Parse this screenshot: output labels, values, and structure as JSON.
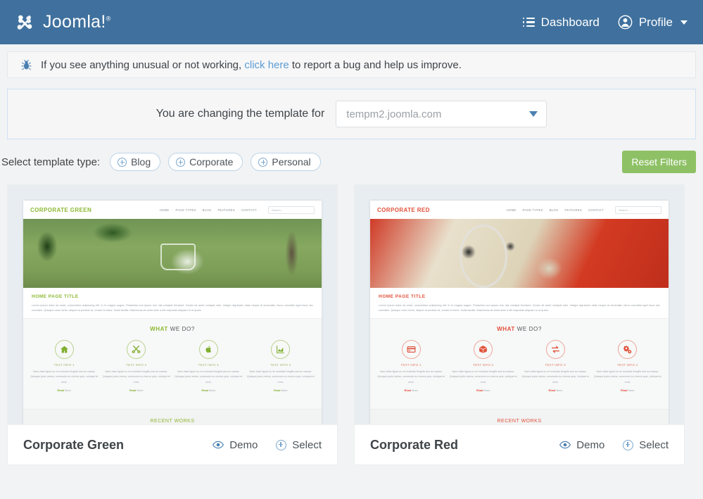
{
  "header": {
    "brand_name": "Joomla!",
    "brand_tm": "®",
    "dashboard_label": "Dashboard",
    "profile_label": "Profile",
    "bg_color": "#40719e"
  },
  "notice": {
    "icon": "bug-icon",
    "text_before": "If you see anything unusual or not working,",
    "link_text": "click here",
    "text_after": "to report a bug and help us improve."
  },
  "template_panel": {
    "label": "You are changing the template for",
    "selected_site": "tempm2.joomla.com"
  },
  "filters": {
    "label": "Select template type:",
    "options": [
      {
        "label": "Blog"
      },
      {
        "label": "Corporate"
      },
      {
        "label": "Personal"
      }
    ],
    "reset_label": "Reset Filters",
    "reset_color": "#8ec165"
  },
  "templates": [
    {
      "name": "Corporate Green",
      "accent": "#8cb831",
      "demo_label": "Demo",
      "select_label": "Select",
      "preview": {
        "brand": "CORPORATE GREEN",
        "nav": [
          "HOME",
          "PAGE TYPES",
          "BLOG",
          "FEATURES",
          "CONTACT"
        ],
        "search_placeholder": "Search...",
        "hero": "garden-patio-photo",
        "page_title": "HOME PAGE TITLE",
        "paragraph": "Lorem ipsum dolor sit amet, consectetur adipiscing elit. In in magna augue. Phasellus non ipsum nec nisl volutpat tincidunt. Donec sit amet volutpat odio. Integer dignissim vitae neque at venenatis. Nunc convallis eget risus nec convallis. Quisque nunc tortor, aliquet ut pretium id, ornare id tortor. Nulla facilisi. Maecenas sit amet ante a elit vulputate aliquam in ut quam.",
        "features_heading_accent": "WHAT",
        "features_heading_rest": "WE DO?",
        "features": [
          {
            "icon": "home-icon",
            "title": "TEXT INFO 1"
          },
          {
            "icon": "scissors-icon",
            "title": "TEXT INFO 2"
          },
          {
            "icon": "apple-icon",
            "title": "TEXT INFO 3"
          },
          {
            "icon": "chart-icon",
            "title": "TEXT INFO 4"
          }
        ],
        "feature_text": "Nam vitae ligula eu mi molestie fringilla sed ac massa. Quisque justo metus, commodo eu viverra quis, volutpat et urna.",
        "read_more_bold": "Read",
        "read_more_rest": " More",
        "footer_heading": "RECENT WORKS"
      }
    },
    {
      "name": "Corporate Red",
      "accent": "#e1503a",
      "demo_label": "Demo",
      "select_label": "Select",
      "preview": {
        "brand": "CORPORATE RED",
        "nav": [
          "HOME",
          "PAGE TYPES",
          "BLOG",
          "FEATURES",
          "CONTACT"
        ],
        "search_placeholder": "Search...",
        "hero": "classic-car-dashboard-photo",
        "page_title": "HOME PAGE TITLE",
        "paragraph": "Lorem ipsum dolor sit amet, consectetur adipiscing elit. In in magna augue. Phasellus non ipsum nec nisl volutpat tincidunt. Donec sit amet volutpat odio. Integer dignissim vitae neque at venenatis. Nunc convallis eget risus nec convallis. Quisque nunc tortor, aliquet ut pretium id, ornare id tortor. Nulla facilisi. Maecenas sit amet ante a elit vulputate aliquam in ut quam.",
        "features_heading_accent": "WHAT",
        "features_heading_rest": "WE DO?",
        "features": [
          {
            "icon": "credit-card-icon",
            "title": "TEXT INFO 1"
          },
          {
            "icon": "box-icon",
            "title": "TEXT INFO 2"
          },
          {
            "icon": "exchange-icon",
            "title": "TEXT INFO 3"
          },
          {
            "icon": "gears-icon",
            "title": "TEXT INFO 4"
          }
        ],
        "feature_text": "Nam vitae ligula eu mi molestie fringilla sed ac massa. Quisque justo metus, commodo eu viverra quis, volutpat et urna.",
        "read_more_bold": "Read",
        "read_more_rest": " More",
        "footer_heading": "RECENT WORKS"
      }
    }
  ]
}
